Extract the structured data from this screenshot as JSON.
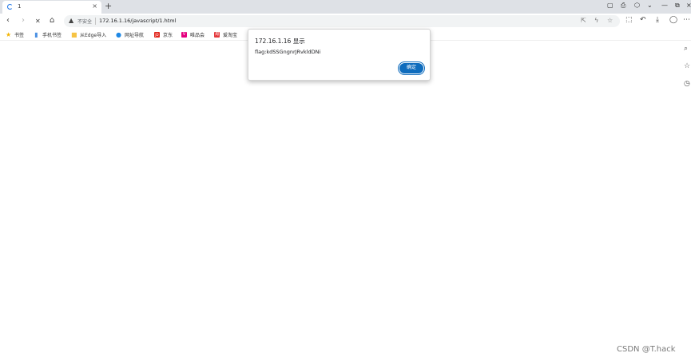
{
  "tab": {
    "title": "1",
    "close": "×"
  },
  "newtab": "+",
  "window_controls": {
    "minimize": "—",
    "maximize": "⧉",
    "close": "×"
  },
  "nav": {
    "back": "‹",
    "forward": "›",
    "stop": "✕",
    "home": "⌂"
  },
  "address": {
    "security_label": "不安全",
    "url": "172.16.1.16/javascript/1.html"
  },
  "bookmarks": [
    {
      "label": "书签",
      "icon": "star-icon",
      "color": "#f4b400",
      "glyph": "★"
    },
    {
      "label": "手机书签",
      "icon": "phone-icon",
      "color": "#4a90e2",
      "glyph": "▮"
    },
    {
      "label": "从Edge导入",
      "icon": "folder-icon",
      "color": "#f6c344",
      "glyph": "■"
    },
    {
      "label": "网址导航",
      "icon": "edge-icon",
      "color": "#1e88e5",
      "glyph": "●"
    },
    {
      "label": "京东",
      "icon": "jd-icon",
      "color": "#e1251b",
      "glyph": "JD"
    },
    {
      "label": "唯品会",
      "icon": "vip-icon",
      "color": "#e5007f",
      "glyph": "V"
    },
    {
      "label": "爱淘宝",
      "icon": "taobao-icon",
      "color": "#e4393c",
      "glyph": "淘"
    }
  ],
  "dialog": {
    "title": "172.16.1.16 显示",
    "message": "flag:kdSSGngnrJRvkldDNi",
    "ok_label": "确定",
    "accent": "#0f6cbd"
  },
  "watermark": "CSDN @T.hack"
}
